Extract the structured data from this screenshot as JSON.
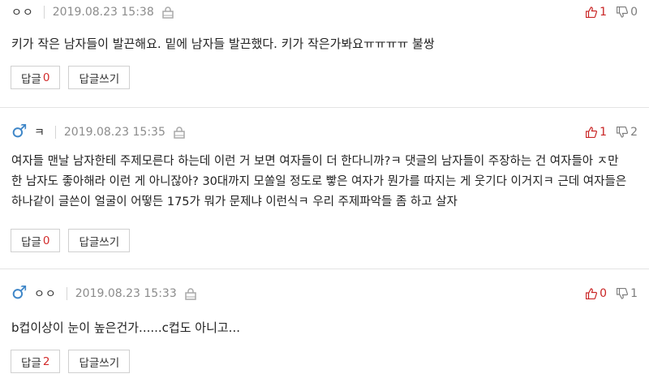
{
  "comments": [
    {
      "nickname": "ㅇㅇ",
      "gender_icon": "",
      "date": "2019.08.23 15:38",
      "upvotes": "1",
      "downvotes": "0",
      "text": "키가 작은 남자들이 발끈해요. 밑에 남자들 발끈했다. 키가 작은가봐요ㅠㅠㅠㅠ 불쌍",
      "reply_label": "답글",
      "reply_count": "0",
      "write_reply_label": "답글쓰기"
    },
    {
      "nickname": "ㅋ",
      "gender_icon": "♂",
      "date": "2019.08.23 15:35",
      "upvotes": "1",
      "downvotes": "2",
      "text_lines": [
        "여자들 맨날 남자한테 주제모른다 하는데 이런 거 보면 여자들이 더 한다니까?ㅋ 댓글의 남자들이 주장하는 건 여자들아 ㅈ만",
        "한 남자도 좋아해라 이런 게 아니잖아? 30대까지 모쏠일 정도로 빻은 여자가 뭔가를 따지는 게 웃기다 이거지ㅋ 근데 여자들은",
        "하나같이 글쓴이 얼굴이 어떻든 175가 뭐가 문제냐 이런식ㅋ 우리 주제파악들 좀 하고 살자"
      ],
      "reply_label": "답글",
      "reply_count": "0",
      "write_reply_label": "답글쓰기"
    },
    {
      "nickname": "ㅇㅇ",
      "gender_icon": "♂",
      "date": "2019.08.23 15:33",
      "upvotes": "0",
      "downvotes": "1",
      "text": "b컵이상이 눈이 높은건가......c컵도 아니고...",
      "reply_label": "답글",
      "reply_count": "2",
      "write_reply_label": "답글쓰기"
    }
  ],
  "colors": {
    "upvote": "#c92525",
    "downvote": "#7d7d7d",
    "male_icon": "#3e86c8",
    "reply_count": "#d22a2a"
  }
}
